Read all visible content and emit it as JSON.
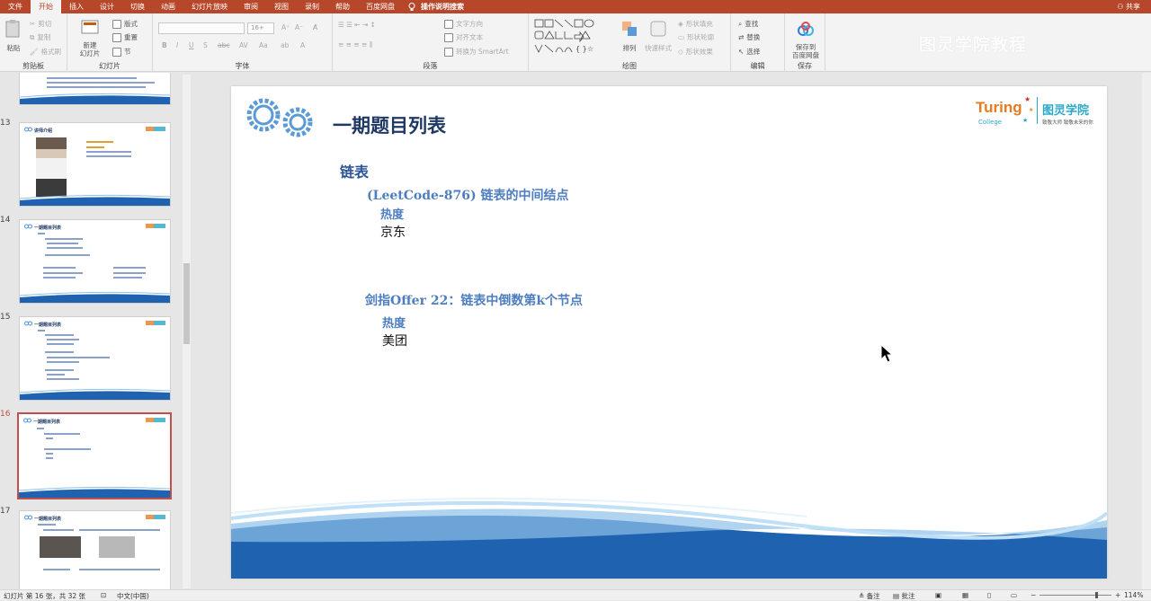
{
  "menu": {
    "tabs": [
      "文件",
      "开始",
      "插入",
      "设计",
      "切换",
      "动画",
      "幻灯片放映",
      "审阅",
      "视图",
      "录制",
      "帮助",
      "百度网盘"
    ],
    "active_tab": "开始",
    "search_label": "操作说明搜索",
    "share_label": "共享"
  },
  "ribbon": {
    "clipboard": {
      "paste": "粘贴",
      "cut": "剪切",
      "copy": "复制",
      "format_painter": "格式刷",
      "group": "剪贴板"
    },
    "slides": {
      "new_slide": "新建\n幻灯片",
      "layout": "版式",
      "reset": "重置",
      "section": "节",
      "group": "幻灯片"
    },
    "font": {
      "font_name": "",
      "font_size": "16+",
      "group": "字体"
    },
    "paragraph": {
      "text_direction": "文字方向",
      "align_text": "对齐文本",
      "smartart": "转换为 SmartArt",
      "group": "段落"
    },
    "drawing": {
      "arrange": "排列",
      "quick_styles": "快速样式",
      "shape_fill": "形状填充",
      "shape_outline": "形状轮廓",
      "shape_effects": "形状效果",
      "group": "绘图"
    },
    "editing": {
      "find": "查找",
      "replace": "替换",
      "select": "选择",
      "group": "编辑"
    },
    "save": {
      "save_to": "保存到\n百度网盘",
      "group": "保存"
    },
    "watermark": "图灵学院教程"
  },
  "thumbnails": [
    {
      "num": "13",
      "title": "讲师介绍"
    },
    {
      "num": "14",
      "title": "一期题目列表"
    },
    {
      "num": "15",
      "title": "一期题目列表"
    },
    {
      "num": "16",
      "title": "一期题目列表",
      "selected": true
    },
    {
      "num": "17",
      "title": "一期题目列表"
    }
  ],
  "slide": {
    "title": "一期题目列表",
    "logo_text": "图灵学院",
    "logo_sub": "致敬大师 致敬未来的你",
    "logo_brand": "Turing",
    "logo_college": "College",
    "section": "链表",
    "items": [
      {
        "name": "(LeetCode-876) 链表的中间结点",
        "heat_label": "热度",
        "company": "京东"
      },
      {
        "name": "剑指Offer 22：链表中倒数第k个节点",
        "heat_label": "热度",
        "company": "美团"
      }
    ]
  },
  "status": {
    "slide_info": "幻灯片 第 16 张，共 32 张",
    "language": "中文(中国)",
    "notes": "备注",
    "comments": "批注",
    "zoom": "114%"
  },
  "colors": {
    "accent": "#b7472a",
    "title": "#1f3864",
    "item": "#4e7ec0",
    "wave_dark": "#1f62b0",
    "wave_light": "#8fc1ea"
  }
}
